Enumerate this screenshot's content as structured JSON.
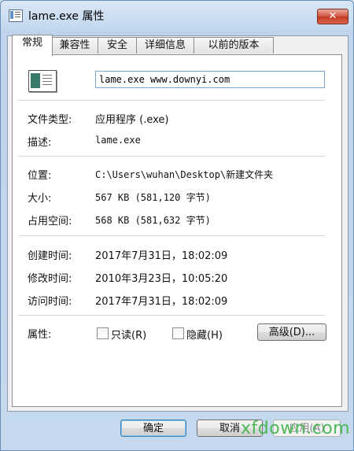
{
  "window": {
    "title": "lame.exe 属性",
    "close_glyph": "✕"
  },
  "tabs": [
    {
      "label": "常规"
    },
    {
      "label": "兼容性"
    },
    {
      "label": "安全"
    },
    {
      "label": "详细信息"
    },
    {
      "label": "以前的版本"
    }
  ],
  "general": {
    "filename_value": "lame.exe www.downyi.com",
    "file_type": {
      "label": "文件类型:",
      "value": "应用程序 (.exe)"
    },
    "description": {
      "label": "描述:",
      "value": "lame.exe"
    },
    "location": {
      "label": "位置:",
      "value": "C:\\Users\\wuhan\\Desktop\\新建文件夹"
    },
    "size": {
      "label": "大小:",
      "value": "567 KB (581,120 字节)"
    },
    "size_on_disk": {
      "label": "占用空间:",
      "value": "568 KB (581,632 字节)"
    },
    "created": {
      "label": "创建时间:",
      "value": "2017年7月31日，18:02:09"
    },
    "modified": {
      "label": "修改时间:",
      "value": "2010年3月23日，10:05:20"
    },
    "accessed": {
      "label": "访问时间:",
      "value": "2017年7月31日，18:02:09"
    },
    "attributes": {
      "label": "属性:",
      "readonly": "只读(R)",
      "hidden": "隐藏(H)",
      "advanced_button": "高级(D)..."
    }
  },
  "buttons": {
    "ok": "确定",
    "cancel": "取消",
    "apply": "应用(A)"
  },
  "watermark": "xfdown.com",
  "icons": {
    "app": "exe-file-icon",
    "close": "close-icon"
  }
}
